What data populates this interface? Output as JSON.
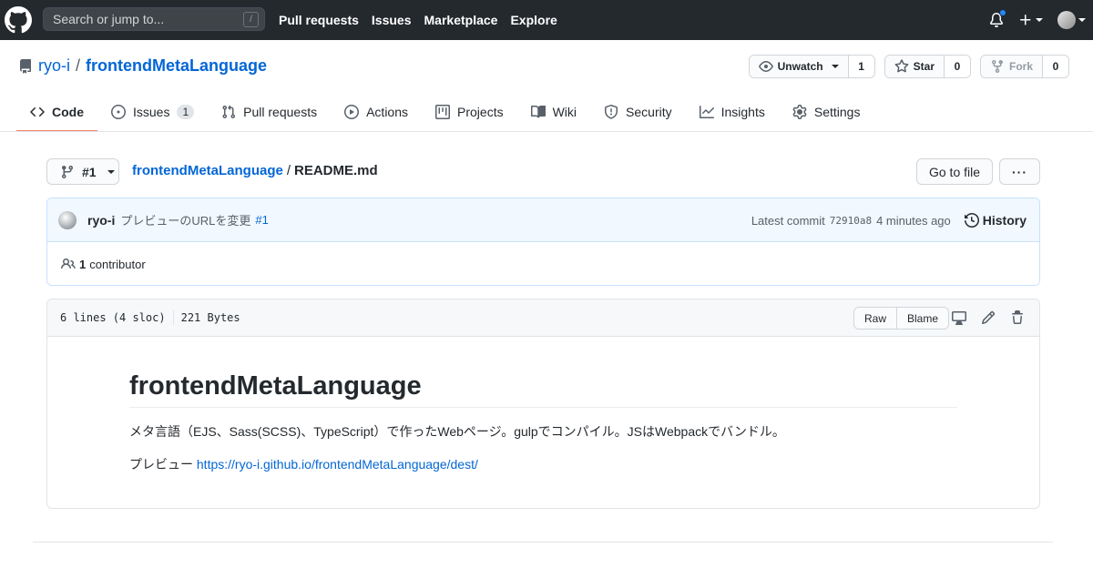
{
  "header": {
    "search_placeholder": "Search or jump to...",
    "search_key": "/",
    "nav": [
      "Pull requests",
      "Issues",
      "Marketplace",
      "Explore"
    ],
    "accent": "#24292e"
  },
  "repo": {
    "owner": "ryo-i",
    "separator": "/",
    "name": "frontendMetaLanguage",
    "watch": {
      "label": "Unwatch",
      "count": "1"
    },
    "star": {
      "label": "Star",
      "count": "0"
    },
    "fork": {
      "label": "Fork",
      "count": "0"
    }
  },
  "tabs": [
    {
      "label": "Code",
      "icon": "code-icon",
      "active": true
    },
    {
      "label": "Issues",
      "icon": "issue-icon",
      "counter": "1"
    },
    {
      "label": "Pull requests",
      "icon": "pull-request-icon"
    },
    {
      "label": "Actions",
      "icon": "play-icon"
    },
    {
      "label": "Projects",
      "icon": "project-icon"
    },
    {
      "label": "Wiki",
      "icon": "book-icon"
    },
    {
      "label": "Security",
      "icon": "shield-icon"
    },
    {
      "label": "Insights",
      "icon": "graph-icon"
    },
    {
      "label": "Settings",
      "icon": "gear-icon"
    }
  ],
  "file_nav": {
    "branch": "#1",
    "repo_link": "frontendMetaLanguage",
    "separator": "/",
    "file_name": "README.md",
    "go_to_file": "Go to file",
    "more": "···"
  },
  "commit": {
    "author": "ryo-i",
    "message": "プレビューのURLを変更",
    "pr": "#1",
    "latest_label": "Latest commit",
    "sha": "72910a8",
    "time": "4 minutes ago",
    "history": "History"
  },
  "contributors": {
    "count": "1",
    "label": "contributor"
  },
  "file": {
    "lines": "6 lines (4 sloc)",
    "size": "221 Bytes",
    "raw": "Raw",
    "blame": "Blame"
  },
  "readme": {
    "title": "frontendMetaLanguage",
    "description": "メタ言語（EJS、Sass(SCSS)、TypeScript）で作ったWebページ。gulpでコンパイル。JSはWebpackでバンドル。",
    "preview_label": "プレビュー",
    "preview_link": "https://ryo-i.github.io/frontendMetaLanguage/dest/"
  }
}
